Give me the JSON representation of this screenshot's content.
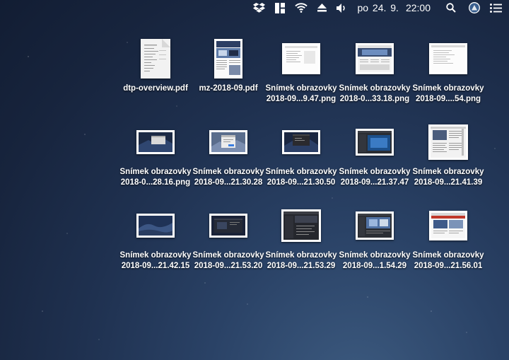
{
  "menubar": {
    "icons": [
      "dropbox-icon",
      "window-layout-icon",
      "wifi-icon",
      "eject-icon",
      "volume-icon"
    ],
    "date": "po 24. 9.",
    "time": "22:00",
    "right_icons": [
      "spotlight-search-icon",
      "user-avatar-icon",
      "notification-center-icon"
    ]
  },
  "desktop": {
    "items": [
      {
        "line1": "dtp-overview.pdf",
        "line2": "",
        "kind": "pdf-doc"
      },
      {
        "line1": "mz-2018-09.pdf",
        "line2": "",
        "kind": "pdf-mag"
      },
      {
        "line1": "Snímek obrazovky",
        "line2": "2018-09...9.47.png",
        "kind": "shot-doc"
      },
      {
        "line1": "Snímek obrazovky",
        "line2": "2018-0...33.18.png",
        "kind": "shot-web"
      },
      {
        "line1": "Snímek obrazovky",
        "line2": "2018-09....54.png",
        "kind": "shot-doc"
      },
      {
        "line1": "Snímek obrazovky",
        "line2": "2018-0...28.16.png",
        "kind": "shot-dark"
      },
      {
        "line1": "Snímek obrazovky",
        "line2": "2018-09...21.30.28",
        "kind": "shot-dialog"
      },
      {
        "line1": "Snímek obrazovky",
        "line2": "2018-09...21.30.50",
        "kind": "shot-dark"
      },
      {
        "line1": "Snímek obrazovky",
        "line2": "2018-09...21.37.47",
        "kind": "shot-app"
      },
      {
        "line1": "Snímek obrazovky",
        "line2": "2018-09...21.41.39",
        "kind": "shot-page"
      },
      {
        "line1": "Snímek obrazovky",
        "line2": "2018-09...21.42.15",
        "kind": "shot-mojave"
      },
      {
        "line1": "Snímek obrazovky",
        "line2": "2018-09...21.53.20",
        "kind": "shot-dark"
      },
      {
        "line1": "Snímek obrazovky",
        "line2": "2018-09...21.53.29",
        "kind": "shot-darkapp"
      },
      {
        "line1": "Snímek obrazovky",
        "line2": "2018-09...1.54.29",
        "kind": "shot-dark2"
      },
      {
        "line1": "Snímek obrazovky",
        "line2": "2018-09...21.56.01",
        "kind": "shot-web"
      }
    ]
  },
  "colors": {
    "menubar_text": "#ffffff",
    "desktop_bg": "#1f3150",
    "label_text": "#ffffff"
  }
}
